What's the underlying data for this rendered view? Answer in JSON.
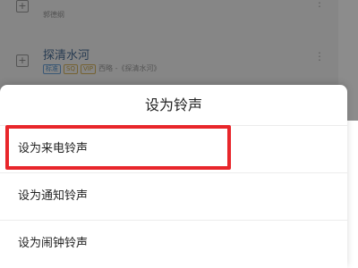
{
  "background_list": {
    "items": [
      {
        "title": "",
        "subtitle": "郭德纲",
        "tags": [],
        "more_glyph": "⋮"
      },
      {
        "title": "探清水河",
        "subtitle": "西略 -《探清水河》",
        "tags": [
          {
            "text": "标准"
          },
          {
            "text": "SQ"
          },
          {
            "text": "VIP"
          }
        ],
        "more_glyph": "⋮"
      }
    ],
    "plus_glyph": "+"
  },
  "sheet": {
    "title": "设为铃声",
    "options": [
      {
        "label": "设为来电铃声",
        "highlighted": true
      },
      {
        "label": "设为通知铃声",
        "highlighted": false
      },
      {
        "label": "设为闹钟铃声",
        "highlighted": false
      }
    ]
  },
  "colors": {
    "highlight": "#e8262b",
    "link_title": "#4a6e96"
  }
}
